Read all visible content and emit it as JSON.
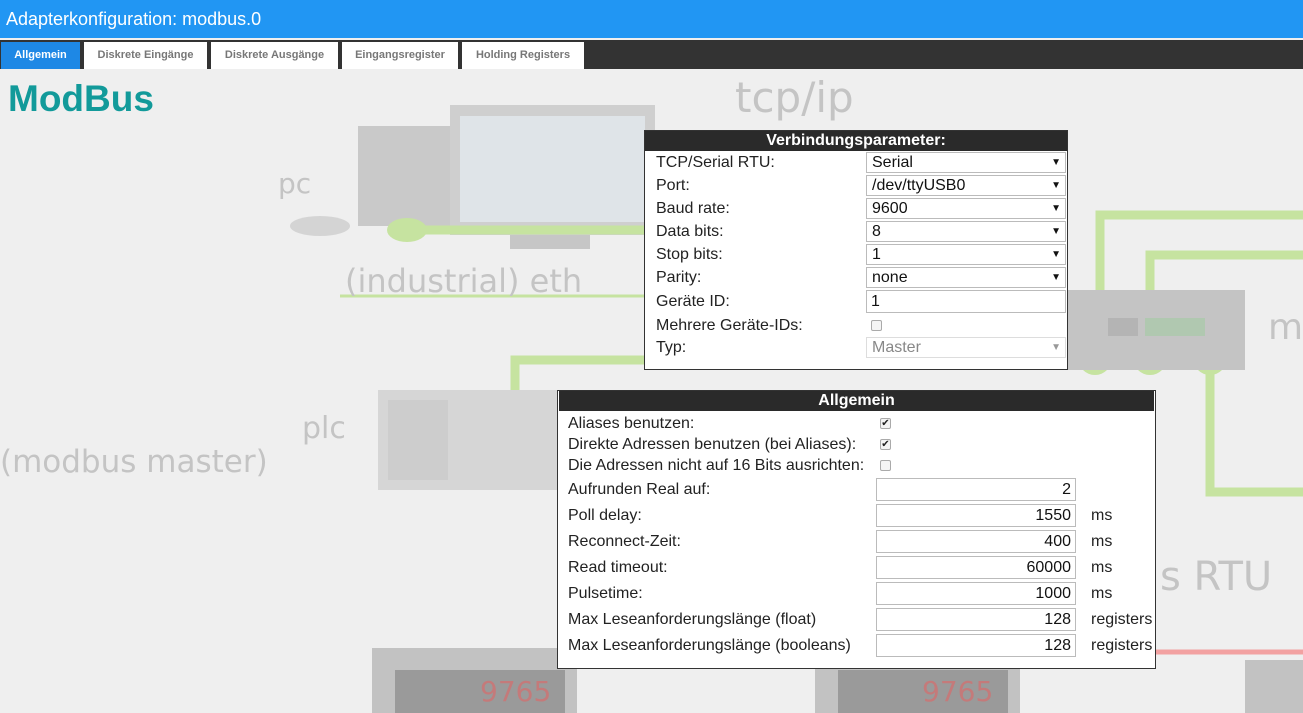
{
  "window": {
    "title": "Adapterkonfiguration: modbus.0"
  },
  "tabs": [
    {
      "label": "Allgemein",
      "active": true
    },
    {
      "label": "Diskrete Eingänge",
      "active": false
    },
    {
      "label": "Diskrete Ausgänge",
      "active": false
    },
    {
      "label": "Eingangsregister",
      "active": false
    },
    {
      "label": "Holding Registers",
      "active": false
    }
  ],
  "page": {
    "heading": "ModBus"
  },
  "background": {
    "tcpip": "tcp/ip",
    "pc": "pc",
    "industrial_eth": "(industrial) eth",
    "plc": "plc",
    "modbus_master": "(modbus master)",
    "rtu": "s RTU",
    "right_letter": "m",
    "display_value": "9765",
    "accent_green": "#c6e3a0",
    "accent_red": "#f2a1a1"
  },
  "connection": {
    "header": "Verbindungsparameter:",
    "fields": {
      "tcp_serial": {
        "label": "TCP/Serial RTU:",
        "value": "Serial"
      },
      "port": {
        "label": "Port:",
        "value": "/dev/ttyUSB0"
      },
      "baud": {
        "label": "Baud rate:",
        "value": "9600"
      },
      "databits": {
        "label": "Data bits:",
        "value": "8"
      },
      "stopbits": {
        "label": "Stop bits:",
        "value": "1"
      },
      "parity": {
        "label": "Parity:",
        "value": "none"
      },
      "geraete_id": {
        "label": "Geräte ID:",
        "value": "1"
      },
      "mehrere": {
        "label": "Mehrere Geräte-IDs:",
        "checked": false
      },
      "typ": {
        "label": "Typ:",
        "value": "Master",
        "disabled": true
      }
    }
  },
  "general": {
    "header": "Allgemein",
    "aliases": {
      "label": "Aliases benutzen:",
      "checked": true
    },
    "direct": {
      "label": "Direkte Adressen benutzen (bei Aliases):",
      "checked": true
    },
    "align": {
      "label": "Die Adressen nicht auf 16 Bits ausrichten:",
      "checked": false
    },
    "round": {
      "label": "Aufrunden Real auf:",
      "value": "2",
      "unit": ""
    },
    "poll": {
      "label": "Poll delay:",
      "value": "1550",
      "unit": "ms"
    },
    "reconnect": {
      "label": "Reconnect-Zeit:",
      "value": "400",
      "unit": "ms"
    },
    "read_timeout": {
      "label": "Read timeout:",
      "value": "60000",
      "unit": "ms"
    },
    "pulsetime": {
      "label": "Pulsetime:",
      "value": "1000",
      "unit": "ms"
    },
    "max_float": {
      "label": "Max Leseanforderungslänge (float)",
      "value": "128",
      "unit": "registers"
    },
    "max_bool": {
      "label": "Max Leseanforderungslänge (booleans)",
      "value": "128",
      "unit": "registers"
    }
  },
  "icons": {
    "dropdown": "chevron-down-icon",
    "check": "check-icon"
  }
}
